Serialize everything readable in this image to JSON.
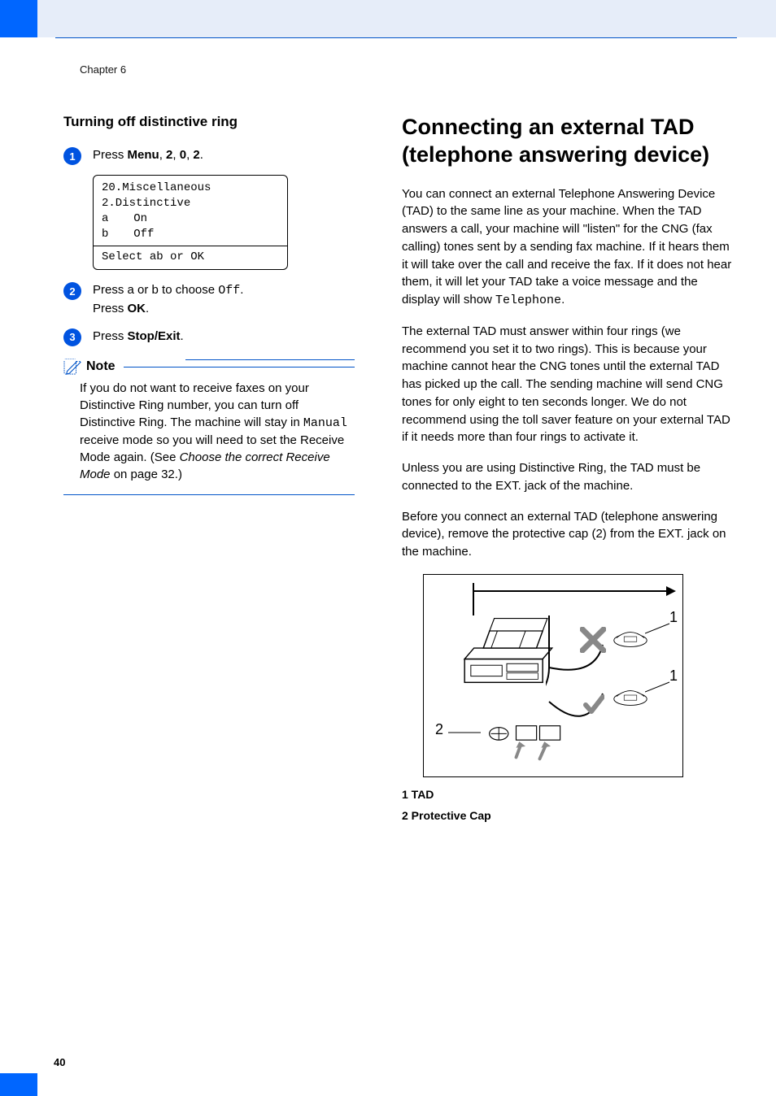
{
  "chapter": "Chapter 6",
  "left": {
    "heading": "Turning off distinctive ring",
    "step1": {
      "prefix": "Press ",
      "b1": "Menu",
      "c1": ", ",
      "b2": "2",
      "c2": ", ",
      "b3": "0",
      "c3": ", ",
      "b4": "2",
      "suffix": "."
    },
    "lcd": {
      "l1": "20.Miscellaneous",
      "l2": "  2.Distinctive",
      "l3_on": "On",
      "l3_off": "Off",
      "footer_pre": "Select ",
      "footer_post": " or OK"
    },
    "step2": {
      "t1": "Press ",
      "t2": " or ",
      "t3": " to choose ",
      "mono": "Off",
      "t4": ".",
      "line2a": "Press ",
      "line2b": "OK",
      "line2c": "."
    },
    "step3": {
      "t1": "Press ",
      "b1": "Stop/Exit",
      "t2": "."
    },
    "note_title": "Note",
    "note_body_a": "If you do not want to receive faxes on your Distinctive Ring number, you can turn off Distinctive Ring. The machine will stay in ",
    "note_mono": "Manual",
    "note_body_b": " receive mode so you will need to set the Receive Mode again. (See ",
    "note_em": "Choose the correct Receive Mode",
    "note_body_c": " on page 32.)"
  },
  "right": {
    "heading": "Connecting an external TAD (telephone answering device)",
    "p1a": "You can connect an external Telephone Answering Device (TAD) to the same line as your machine. When the TAD answers a call, your machine will \"listen\" for the CNG (fax calling) tones sent by a sending fax machine. If it hears them it will take over the call and receive the fax. If it does not hear them, it will let your TAD take a voice message and the display will show ",
    "p1mono": "Telephone",
    "p1b": ".",
    "p2": "The external TAD must answer within four rings (we recommend you set it to two rings). This is because your machine cannot hear the CNG tones until the external TAD has picked up the call. The sending machine will send CNG tones for only eight to ten seconds longer. We do not recommend using the toll saver feature on your external TAD if it needs more than four rings to activate it.",
    "p3": "Unless you are using Distinctive Ring, the TAD must be connected to the EXT. jack of the machine.",
    "p4": "Before you connect an external TAD (telephone answering device), remove the protective cap (2) from the EXT. jack on the machine.",
    "diagram": {
      "callout1a": "1",
      "callout1b": "1",
      "callout2": "2",
      "legend1": "1   TAD",
      "legend2": "2   Protective Cap"
    }
  },
  "page_num": "40"
}
